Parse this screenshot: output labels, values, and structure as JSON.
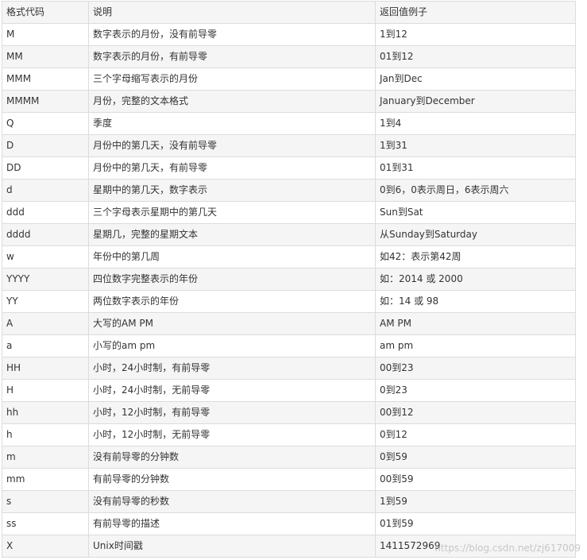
{
  "table": {
    "headers": [
      "格式代码",
      "说明",
      "返回值例子"
    ],
    "rows": [
      [
        "M",
        "数字表示的月份，没有前导零",
        "1到12"
      ],
      [
        "MM",
        "数字表示的月份，有前导零",
        "01到12"
      ],
      [
        "MMM",
        "三个字母缩写表示的月份",
        "Jan到Dec"
      ],
      [
        "MMMM",
        "月份，完整的文本格式",
        "January到December"
      ],
      [
        "Q",
        "季度",
        "1到4"
      ],
      [
        "D",
        "月份中的第几天，没有前导零",
        "1到31"
      ],
      [
        "DD",
        "月份中的第几天，有前导零",
        "01到31"
      ],
      [
        "d",
        "星期中的第几天，数字表示",
        "0到6，0表示周日，6表示周六"
      ],
      [
        "ddd",
        "三个字母表示星期中的第几天",
        "Sun到Sat"
      ],
      [
        "dddd",
        "星期几，完整的星期文本",
        "从Sunday到Saturday"
      ],
      [
        "w",
        "年份中的第几周",
        "如42：表示第42周"
      ],
      [
        "YYYY",
        "四位数字完整表示的年份",
        "如：2014 或 2000"
      ],
      [
        "YY",
        "两位数字表示的年份",
        "如：14 或 98"
      ],
      [
        "A",
        "大写的AM PM",
        "AM PM"
      ],
      [
        "a",
        "小写的am pm",
        "am pm"
      ],
      [
        "HH",
        "小时，24小时制，有前导零",
        "00到23"
      ],
      [
        "H",
        "小时，24小时制，无前导零",
        "0到23"
      ],
      [
        "hh",
        "小时，12小时制，有前导零",
        "00到12"
      ],
      [
        "h",
        "小时，12小时制，无前导零",
        "0到12"
      ],
      [
        "m",
        "没有前导零的分钟数",
        "0到59"
      ],
      [
        "mm",
        "有前导零的分钟数",
        "00到59"
      ],
      [
        "s",
        "没有前导零的秒数",
        "1到59"
      ],
      [
        "ss",
        "有前导零的描述",
        "01到59"
      ],
      [
        "X",
        "Unix时间戳",
        "1411572969"
      ]
    ]
  },
  "watermark": "https://blog.csdn.net/zj617009"
}
